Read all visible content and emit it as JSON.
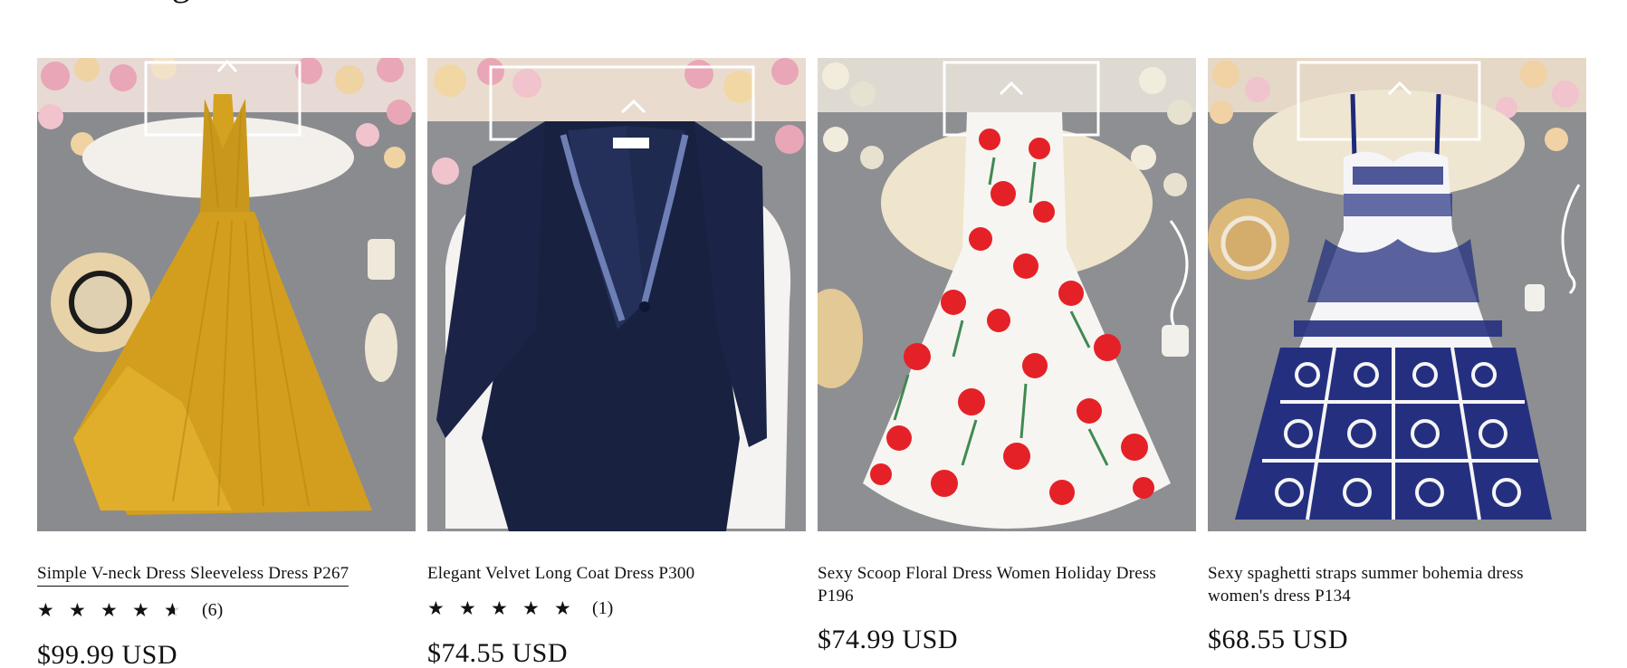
{
  "products": [
    {
      "title": "Simple V-neck Dress Sleeveless Dress P267",
      "rating": 4.5,
      "review_count": "(6)",
      "price": "$99.99 USD",
      "image_alt": "Mustard yellow pleated v-neck sleeveless maxi dress"
    },
    {
      "title": "Elegant Velvet Long Coat Dress P300",
      "rating": 5,
      "review_count": "(1)",
      "price": "$74.55 USD",
      "image_alt": "Navy velvet long coat dress with satin lapels"
    },
    {
      "title": "Sexy Scoop Floral Dress Women Holiday Dress P196",
      "price": "$74.99 USD",
      "image_alt": "White sleeveless dress with red poppy print"
    },
    {
      "title": "Sexy spaghetti straps summer bohemia dress women's dress P134",
      "price": "$68.55 USD",
      "image_alt": "Blue and white tile print spaghetti strap maxi dress"
    }
  ],
  "colors": {
    "text": "#121212",
    "background": "#ffffff",
    "star": "#121212"
  }
}
